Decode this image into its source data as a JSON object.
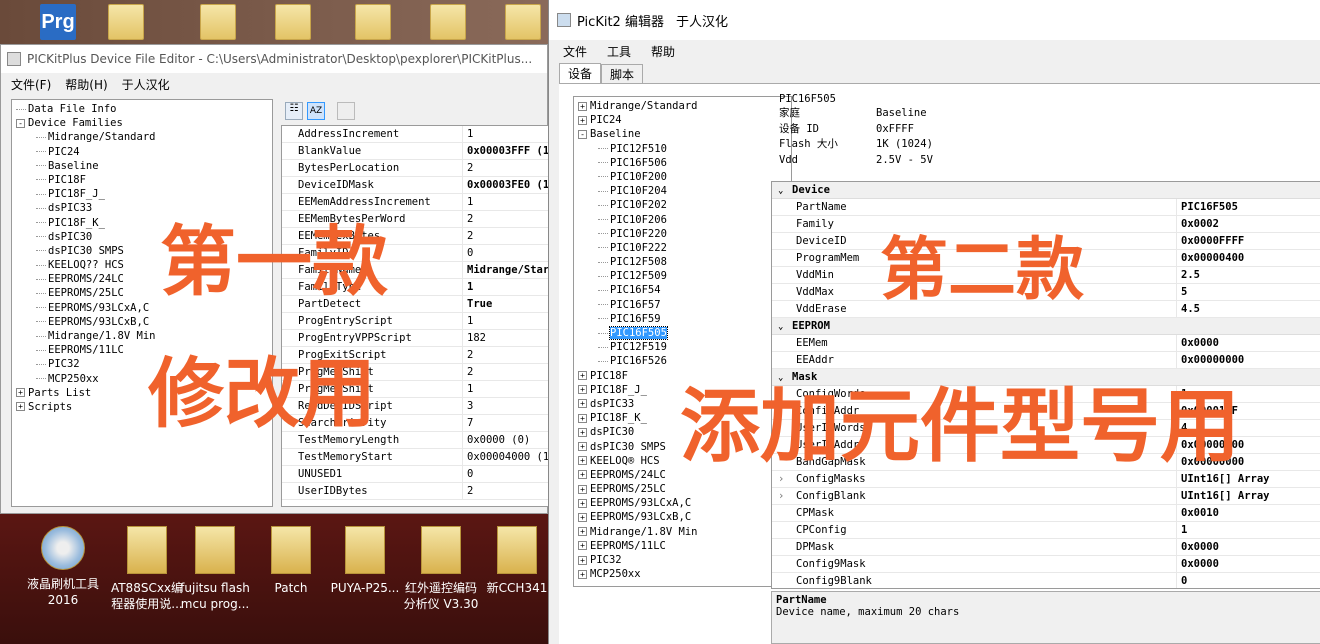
{
  "desktop": {
    "top_icon_label": "Prg",
    "bottom_icons": [
      {
        "label1": "液晶刷机工具",
        "label2": "2016"
      },
      {
        "label1": "AT88SCxx编",
        "label2": "程器使用说..."
      },
      {
        "label1": "fujitsu flash",
        "label2": "mcu prog..."
      },
      {
        "label1": "Patch",
        "label2": ""
      },
      {
        "label1": "PUYA-P25...",
        "label2": ""
      },
      {
        "label1": "红外遥控编码",
        "label2": "分析仪 V3.30"
      },
      {
        "label1": "新CCH341",
        "label2": ""
      }
    ]
  },
  "win1": {
    "title": "PICKitPlus Device File Editor - C:\\Users\\Administrator\\Desktop\\pexplorer\\PICKitPlus...",
    "menu": [
      "文件(F)",
      "帮助(H)",
      "于人汉化"
    ],
    "tree": [
      {
        "label": "Data File Info",
        "level": 0,
        "pm": ""
      },
      {
        "label": "Device Families",
        "level": 0,
        "pm": "-"
      },
      {
        "label": "Midrange/Standard",
        "level": 1,
        "pm": ""
      },
      {
        "label": "PIC24",
        "level": 1,
        "pm": ""
      },
      {
        "label": "Baseline",
        "level": 1,
        "pm": ""
      },
      {
        "label": "PIC18F",
        "level": 1,
        "pm": ""
      },
      {
        "label": "PIC18F_J_",
        "level": 1,
        "pm": ""
      },
      {
        "label": "dsPIC33",
        "level": 1,
        "pm": ""
      },
      {
        "label": "PIC18F_K_",
        "level": 1,
        "pm": ""
      },
      {
        "label": "dsPIC30",
        "level": 1,
        "pm": ""
      },
      {
        "label": "dsPIC30 SMPS",
        "level": 1,
        "pm": ""
      },
      {
        "label": "KEELOQ?? HCS",
        "level": 1,
        "pm": ""
      },
      {
        "label": "EEPROMS/24LC",
        "level": 1,
        "pm": ""
      },
      {
        "label": "EEPROMS/25LC",
        "level": 1,
        "pm": ""
      },
      {
        "label": "EEPROMS/93LCxA,C",
        "level": 1,
        "pm": ""
      },
      {
        "label": "EEPROMS/93LCxB,C",
        "level": 1,
        "pm": ""
      },
      {
        "label": "Midrange/1.8V Min",
        "level": 1,
        "pm": ""
      },
      {
        "label": "EEPROMS/11LC",
        "level": 1,
        "pm": ""
      },
      {
        "label": "PIC32",
        "level": 1,
        "pm": ""
      },
      {
        "label": "MCP250xx",
        "level": 1,
        "pm": ""
      },
      {
        "label": "Parts List",
        "level": 0,
        "pm": "+"
      },
      {
        "label": "Scripts",
        "level": 0,
        "pm": "+"
      }
    ],
    "props": [
      {
        "name": "AddressIncrement",
        "value": "1"
      },
      {
        "name": "BlankValue",
        "value": "0x00003FFF (1"
      },
      {
        "name": "BytesPerLocation",
        "value": "2"
      },
      {
        "name": "DeviceIDMask",
        "value": "0x00003FE0 (1"
      },
      {
        "name": "EEMemAddressIncrement",
        "value": "1"
      },
      {
        "name": "EEMemBytesPerWord",
        "value": "2"
      },
      {
        "name": "EEMemHexBytes",
        "value": "2"
      },
      {
        "name": "FamilyID",
        "value": "0"
      },
      {
        "name": "FamilyName",
        "value": "Midrange/Star"
      },
      {
        "name": "FamilyType",
        "value": "1"
      },
      {
        "name": "PartDetect",
        "value": "True"
      },
      {
        "name": "ProgEntryScript",
        "value": "1"
      },
      {
        "name": "ProgEntryVPPScript",
        "value": "182"
      },
      {
        "name": "ProgExitScript",
        "value": "2"
      },
      {
        "name": "ProgMemShift",
        "value": "2"
      },
      {
        "name": "ProgMemShift",
        "value": "1"
      },
      {
        "name": "ReadDevIDScript",
        "value": "3"
      },
      {
        "name": "SearchPriority",
        "value": "7"
      },
      {
        "name": "TestMemoryLength",
        "value": "0x0000 (0)"
      },
      {
        "name": "TestMemoryStart",
        "value": "0x00004000 (1"
      },
      {
        "name": "UNUSED1",
        "value": "0"
      },
      {
        "name": "UserIDBytes",
        "value": "2"
      }
    ],
    "overlay_line1": "第一款",
    "overlay_line2": "修改用"
  },
  "win2": {
    "title": "PicKit2 编辑器",
    "title_suffix": "于人汉化",
    "menu": [
      "文件",
      "工具",
      "帮助"
    ],
    "tabs": [
      "设备",
      "脚本"
    ],
    "tree": [
      {
        "label": "Midrange/Standard",
        "level": 0,
        "pm": "+"
      },
      {
        "label": "PIC24",
        "level": 0,
        "pm": "+"
      },
      {
        "label": "Baseline",
        "level": 0,
        "pm": "-"
      },
      {
        "label": "PIC12F510",
        "level": 1,
        "pm": ""
      },
      {
        "label": "PIC16F506",
        "level": 1,
        "pm": ""
      },
      {
        "label": "PIC10F200",
        "level": 1,
        "pm": ""
      },
      {
        "label": "PIC10F204",
        "level": 1,
        "pm": ""
      },
      {
        "label": "PIC10F202",
        "level": 1,
        "pm": ""
      },
      {
        "label": "PIC10F206",
        "level": 1,
        "pm": ""
      },
      {
        "label": "PIC10F220",
        "level": 1,
        "pm": ""
      },
      {
        "label": "PIC10F222",
        "level": 1,
        "pm": ""
      },
      {
        "label": "PIC12F508",
        "level": 1,
        "pm": ""
      },
      {
        "label": "PIC12F509",
        "level": 1,
        "pm": ""
      },
      {
        "label": "PIC16F54",
        "level": 1,
        "pm": ""
      },
      {
        "label": "PIC16F57",
        "level": 1,
        "pm": ""
      },
      {
        "label": "PIC16F59",
        "level": 1,
        "pm": ""
      },
      {
        "label": "PIC16F505",
        "level": 1,
        "pm": "",
        "selected": true
      },
      {
        "label": "PIC12F519",
        "level": 1,
        "pm": ""
      },
      {
        "label": "PIC16F526",
        "level": 1,
        "pm": ""
      },
      {
        "label": "PIC18F",
        "level": 0,
        "pm": "+"
      },
      {
        "label": "PIC18F_J_",
        "level": 0,
        "pm": "+"
      },
      {
        "label": "dsPIC33",
        "level": 0,
        "pm": "+"
      },
      {
        "label": "PIC18F_K_",
        "level": 0,
        "pm": "+"
      },
      {
        "label": "dsPIC30",
        "level": 0,
        "pm": "+"
      },
      {
        "label": "dsPIC30 SMPS",
        "level": 0,
        "pm": "+"
      },
      {
        "label": "KEELOQ® HCS",
        "level": 0,
        "pm": "+"
      },
      {
        "label": "EEPROMS/24LC",
        "level": 0,
        "pm": "+"
      },
      {
        "label": "EEPROMS/25LC",
        "level": 0,
        "pm": "+"
      },
      {
        "label": "EEPROMS/93LCxA,C",
        "level": 0,
        "pm": "+"
      },
      {
        "label": "EEPROMS/93LCxB,C",
        "level": 0,
        "pm": "+"
      },
      {
        "label": "Midrange/1.8V Min",
        "level": 0,
        "pm": "+"
      },
      {
        "label": "EEPROMS/11LC",
        "level": 0,
        "pm": "+"
      },
      {
        "label": "PIC32",
        "level": 0,
        "pm": "+"
      },
      {
        "label": "MCP250xx",
        "level": 0,
        "pm": "+"
      }
    ],
    "info": {
      "header": "PIC16F505",
      "rows": [
        {
          "label": "家庭",
          "value": "Baseline"
        },
        {
          "label": "设备 ID",
          "value": "0xFFFF"
        },
        {
          "label": "Flash 大小",
          "value": "1K (1024)"
        },
        {
          "label": "Vdd",
          "value": "2.5V - 5V"
        }
      ]
    },
    "props": [
      {
        "cat": "Device"
      },
      {
        "name": "PartName",
        "value": "PIC16F505"
      },
      {
        "name": "Family",
        "value": "0x0002"
      },
      {
        "name": "DeviceID",
        "value": "0x0000FFFF"
      },
      {
        "name": "ProgramMem",
        "value": "0x00000400"
      },
      {
        "name": "VddMin",
        "value": "2.5"
      },
      {
        "name": "VddMax",
        "value": "5"
      },
      {
        "name": "VddErase",
        "value": "4.5"
      },
      {
        "cat": "EEPROM"
      },
      {
        "name": "EEMem",
        "value": "0x0000"
      },
      {
        "name": "EEAddr",
        "value": "0x00000000"
      },
      {
        "cat": "Mask"
      },
      {
        "name": "ConfigWords",
        "value": "1"
      },
      {
        "name": "ConfigAddr",
        "value": "0x00001FF"
      },
      {
        "name": "UserIDWords",
        "value": "4"
      },
      {
        "name": "UserIDAddr",
        "value": "0x00000800"
      },
      {
        "name": "BandGapMask",
        "value": "0x00000000"
      },
      {
        "name": "ConfigMasks",
        "value": "UInt16[] Array",
        "expand": true
      },
      {
        "name": "ConfigBlank",
        "value": "UInt16[] Array",
        "expand": true
      },
      {
        "name": "CPMask",
        "value": "0x0010"
      },
      {
        "name": "CPConfig",
        "value": "1"
      },
      {
        "name": "DPMask",
        "value": "0x0000"
      },
      {
        "name": "Config9Mask",
        "value": "0x0000"
      },
      {
        "name": "Config9Blank",
        "value": "0"
      }
    ],
    "desc_title": "PartName",
    "desc_text": "Device name, maximum 20 chars",
    "overlay_line1": "第二款",
    "overlay_line2": "添加元件型号用"
  }
}
